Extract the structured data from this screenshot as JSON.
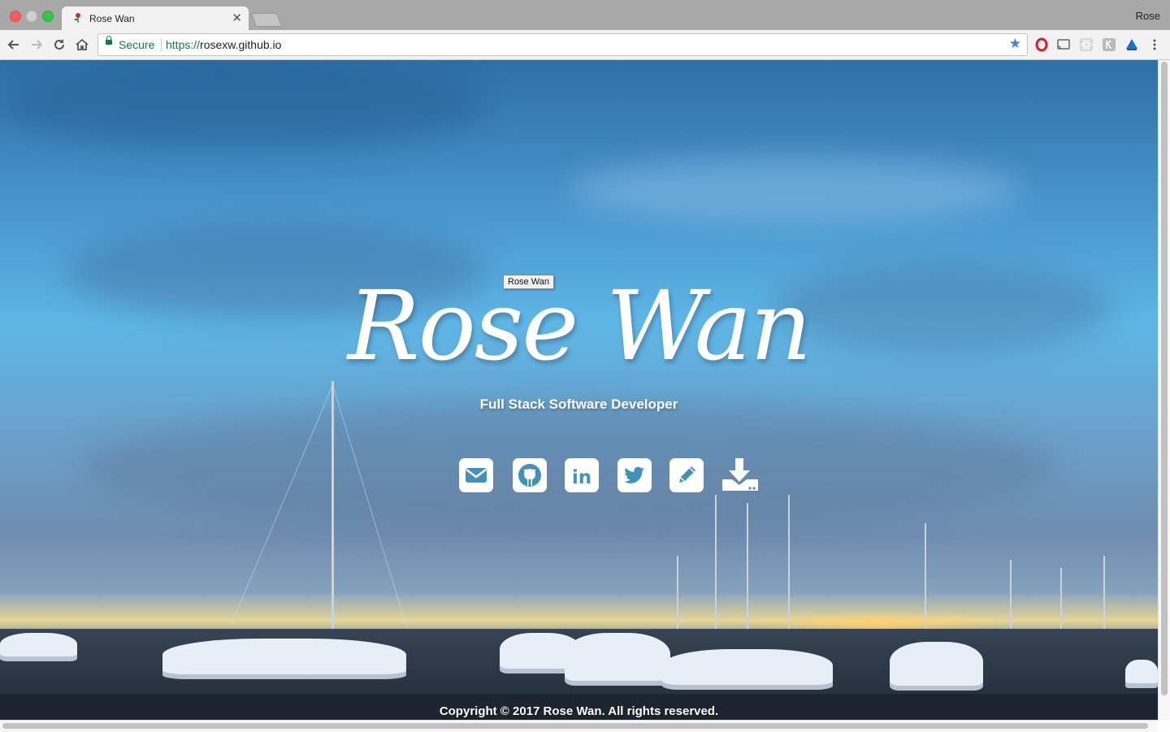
{
  "browser": {
    "tab_title": "Rose Wan",
    "profile_name": "Rose",
    "secure_label": "Secure",
    "url_scheme": "https://",
    "url_host": "rosexw.github.io",
    "icons": {
      "back": "back-arrow-icon",
      "forward": "forward-arrow-icon",
      "reload": "reload-icon",
      "home": "home-icon",
      "bookmark": "star-icon"
    },
    "extensions": [
      "opera-icon",
      "cast-icon",
      "react-devtools-icon",
      "extension-k-icon",
      "google-drive-icon"
    ],
    "colors": {
      "secure_green": "#0b8043",
      "star_blue": "#3b82e8"
    }
  },
  "hero": {
    "name": "Rose Wan",
    "tooltip": "Rose Wan",
    "subtitle": "Full Stack Software Developer",
    "social_icons": [
      "email-icon",
      "github-icon",
      "linkedin-icon",
      "twitter-icon",
      "blog-pencil-icon",
      "resume-download-icon"
    ]
  },
  "footer": {
    "copyright": "Copyright © 2017 Rose Wan. All rights reserved."
  }
}
